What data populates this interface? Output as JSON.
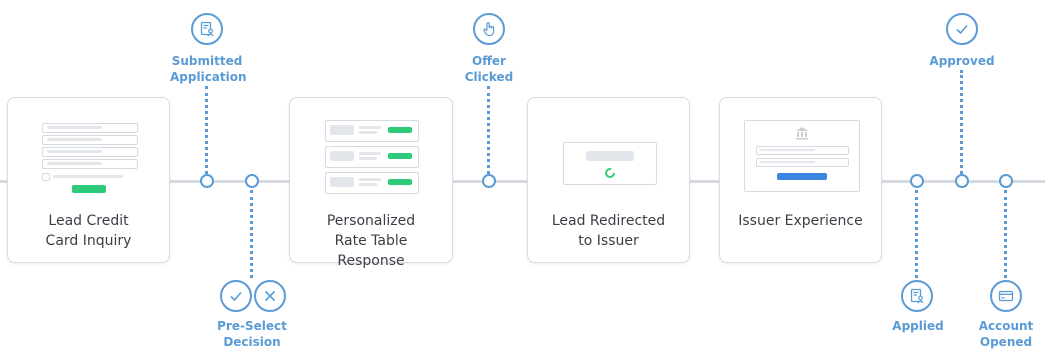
{
  "stages": [
    {
      "title": "Lead Credit Card Inquiry"
    },
    {
      "title": "Personalized Rate Table Response"
    },
    {
      "title": "Lead Redirected to Issuer"
    },
    {
      "title": "Issuer Experience"
    }
  ],
  "milestones": {
    "submitted_application": "Submitted Application",
    "pre_select_decision": "Pre-Select Decision",
    "offer_clicked": "Offer Clicked",
    "approved": "Approved",
    "applied": "Applied",
    "account_opened": "Account Opened"
  },
  "colors": {
    "accent": "#5b9bd5",
    "green": "#2ecc7a",
    "blue_button": "#3a86e0",
    "line": "#d6dbe1"
  },
  "icons": {
    "submitted_application": "document-user-icon",
    "pre_select_accept": "check-icon",
    "pre_select_reject": "x-icon",
    "offer_clicked": "hand-pointer-icon",
    "approved": "check-icon",
    "applied": "document-user-icon",
    "account_opened": "credit-card-icon"
  }
}
